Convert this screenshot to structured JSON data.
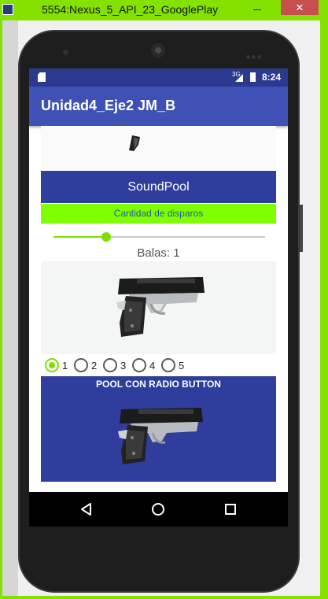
{
  "window": {
    "title": "5554:Nexus_5_API_23_GooglePlay",
    "minimize_glyph": "—",
    "close_glyph": "✕"
  },
  "status_bar": {
    "time": "8:24",
    "network": "3G",
    "icons": [
      "sd-card-icon",
      "signal-icon",
      "battery-icon"
    ]
  },
  "app_bar": {
    "title": "Unidad4_Eje2 JM_B"
  },
  "main": {
    "soundpool_button": "SoundPool",
    "disparos_button": "Cantidad de disparos",
    "seekbar": {
      "fraction": 0.25
    },
    "balas_label": "Balas: 1",
    "radio_options": [
      {
        "label": "1",
        "checked": true
      },
      {
        "label": "2",
        "checked": false
      },
      {
        "label": "3",
        "checked": false
      },
      {
        "label": "4",
        "checked": false
      },
      {
        "label": "5",
        "checked": false
      }
    ],
    "pool_title": "POOL CON RADIO BUTTON"
  },
  "colors": {
    "accent": "#7fe000",
    "primary": "#3f51b5",
    "primary_dark": "#2b3a8f",
    "button_blue": "#2f3d9c",
    "button_green": "#7fff00"
  },
  "nav_bar": {
    "icons": [
      "back-icon",
      "home-icon",
      "recent-apps-icon"
    ]
  }
}
